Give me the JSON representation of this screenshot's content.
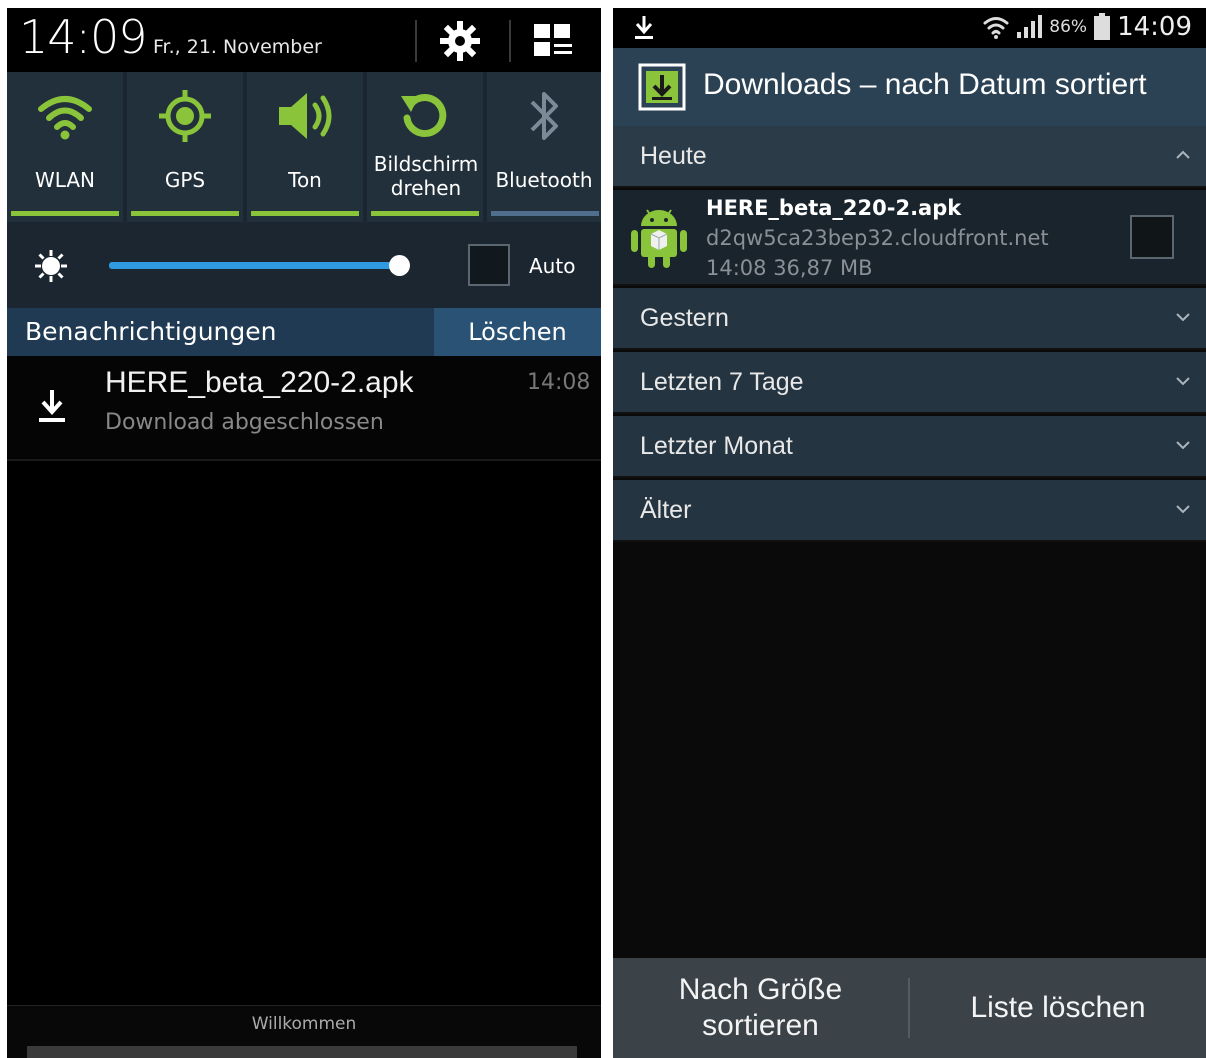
{
  "left_panel": {
    "clock": "14:09",
    "date": "Fr., 21. November",
    "header_icons": [
      "gear-icon",
      "grid-edit-icon"
    ],
    "quick_settings": [
      {
        "label": "WLAN",
        "icon": "wifi-icon",
        "active": true
      },
      {
        "label": "GPS",
        "icon": "gps-icon",
        "active": true
      },
      {
        "label": "Ton",
        "icon": "speaker-icon",
        "active": true
      },
      {
        "label": "Bildschirm drehen",
        "icon": "rotate-icon",
        "active": true
      },
      {
        "label": "Bluetooth",
        "icon": "bluetooth-icon",
        "active": false
      }
    ],
    "brightness": {
      "level": 0.98,
      "auto_label": "Auto",
      "auto_checked": false
    },
    "notifications": {
      "title": "Benachrichtigungen",
      "clear_label": "Löschen",
      "items": [
        {
          "title": "HERE_beta_220-2.apk",
          "subtitle": "Download abgeschlossen",
          "time": "14:08",
          "icon": "download-icon"
        }
      ]
    },
    "footer": {
      "text": "Willkommen"
    }
  },
  "right_panel": {
    "status_bar": {
      "battery": "86%",
      "time": "14:09"
    },
    "action_bar": {
      "title": "Downloads – nach Datum sortiert"
    },
    "sections": [
      {
        "label": "Heute",
        "expanded": true
      },
      {
        "label": "Gestern",
        "expanded": false
      },
      {
        "label": "Letzten 7 Tage",
        "expanded": false
      },
      {
        "label": "Letzter Monat",
        "expanded": false
      },
      {
        "label": "Älter",
        "expanded": false
      }
    ],
    "downloads": [
      {
        "name": "HERE_beta_220-2.apk",
        "host": "d2qw5ca23bep32.cloudfront.net",
        "meta": "14:08  36,87 MB",
        "checked": false
      }
    ],
    "bottom_actions": {
      "sort_label": "Nach Größe sortieren",
      "clear_label": "Liste löschen"
    }
  },
  "colors": {
    "accent_green": "#8ac43b",
    "accent_blue": "#2f9adf",
    "panel_bg": "#1c2630",
    "notif_bar": "#1f3a52",
    "action_bar": "#2b4254"
  }
}
